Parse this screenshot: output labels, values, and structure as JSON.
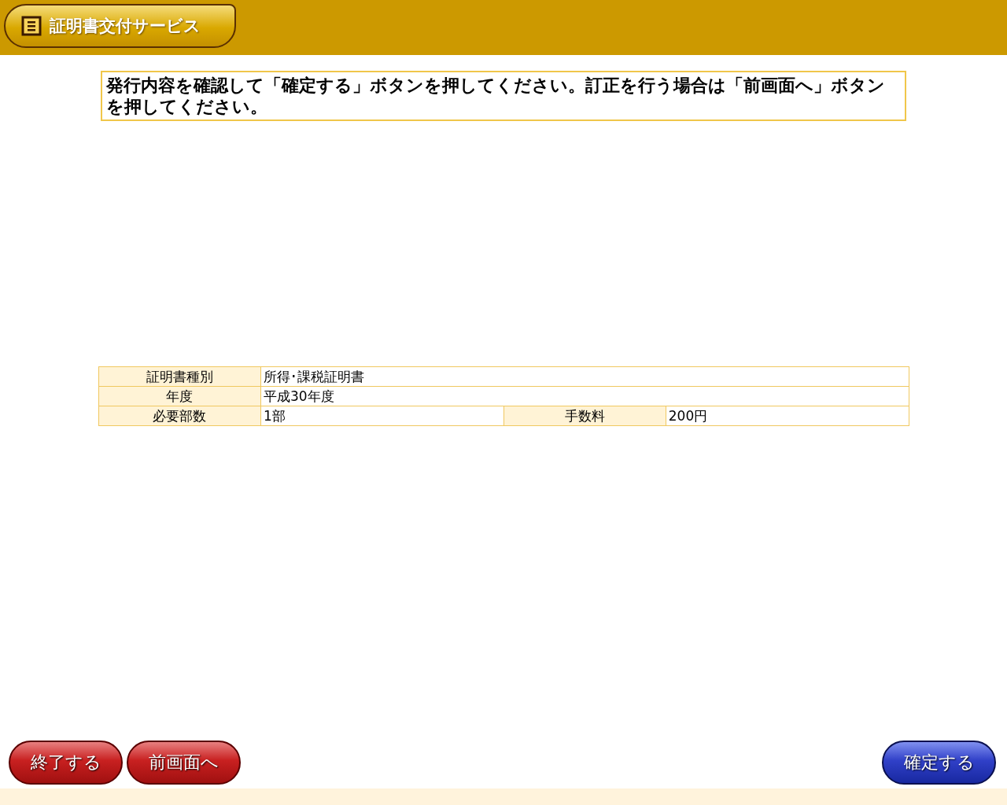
{
  "header": {
    "title": "証明書交付サービス"
  },
  "instruction": "発行内容を確認して「確定する」ボタンを押してください。訂正を行う場合は「前画面へ」ボタンを押してください。",
  "table": {
    "rows": [
      {
        "fields": [
          {
            "label": "証明書種別",
            "value": "所得･課税証明書"
          }
        ]
      },
      {
        "fields": [
          {
            "label": "年度",
            "value": "平成30年度"
          }
        ]
      },
      {
        "fields": [
          {
            "label": "必要部数",
            "value": "1部"
          },
          {
            "label": "手数料",
            "value": "200円"
          }
        ]
      }
    ]
  },
  "left_buttons": [
    {
      "label": "終了する",
      "kind": "secondary"
    },
    {
      "label": "前画面へ",
      "kind": "secondary"
    }
  ],
  "right_buttons": [
    {
      "label": "確定する",
      "kind": "primary"
    }
  ]
}
